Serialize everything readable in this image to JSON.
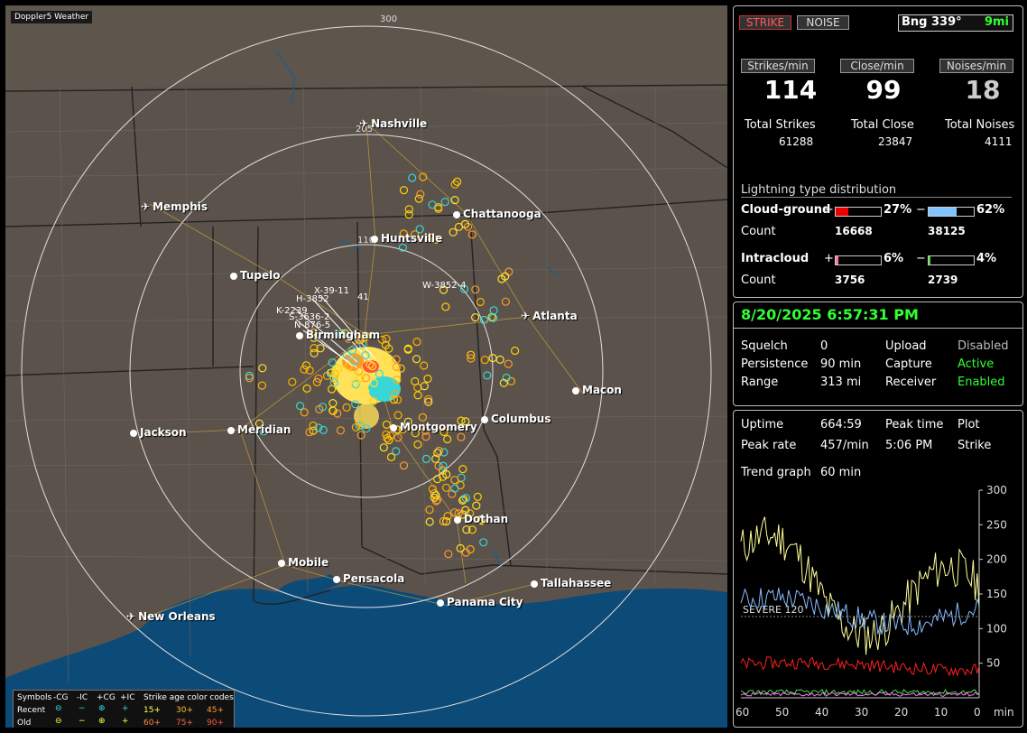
{
  "app_title": "Doppler5 Weather",
  "map": {
    "rings": [
      {
        "label": "300"
      },
      {
        "label": "205"
      },
      {
        "label": "110"
      }
    ],
    "cities": [
      {
        "name": "Nashville",
        "icon": "airport"
      },
      {
        "name": "Memphis",
        "icon": "airport"
      },
      {
        "name": "Chattanooga",
        "icon": "dot"
      },
      {
        "name": "Huntsville",
        "icon": "dot"
      },
      {
        "name": "Tupelo",
        "icon": "dot"
      },
      {
        "name": "Atlanta",
        "icon": "airport"
      },
      {
        "name": "Birmingham",
        "icon": "dot"
      },
      {
        "name": "Macon",
        "icon": "dot"
      },
      {
        "name": "Jackson",
        "icon": "dot"
      },
      {
        "name": "Meridian",
        "icon": "dot"
      },
      {
        "name": "Montgomery",
        "icon": "dot"
      },
      {
        "name": "Columbus",
        "icon": "dot"
      },
      {
        "name": "Dothan",
        "icon": "dot"
      },
      {
        "name": "Mobile",
        "icon": "dot"
      },
      {
        "name": "Pensacola",
        "icon": "dot"
      },
      {
        "name": "Tallahassee",
        "icon": "dot"
      },
      {
        "name": "Panama City",
        "icon": "dot"
      },
      {
        "name": "New Orleans",
        "icon": "airport"
      }
    ],
    "storm_labels": [
      "X-39-11",
      "H-3852",
      "K-2239",
      "S-3636-2",
      "N-876-5",
      "W-3852-4",
      "41"
    ],
    "legend": {
      "symbols_label": "Symbols",
      "headers": [
        "-CG",
        "-IC",
        "+CG",
        "+IC"
      ],
      "age_title": "Strike age color codes",
      "recent_label": "Recent",
      "old_label": "Old",
      "recent_ages": [
        "15+",
        "30+",
        "45+"
      ],
      "old_ages": [
        "60+",
        "75+",
        "90+"
      ]
    }
  },
  "panel": {
    "strike_btn": "STRIKE",
    "noise_btn": "NOISE",
    "bearing": "Bng 339°",
    "distance": "9mi",
    "rate_labels": [
      "Strikes/min",
      "Close/min",
      "Noises/min"
    ],
    "rates": [
      "114",
      "99",
      "18"
    ],
    "total_labels": [
      "Total Strikes",
      "Total Close",
      "Total Noises"
    ],
    "totals": [
      "61288",
      "23847",
      "4111"
    ],
    "dist_title": "Lightning type distribution",
    "cloud_ground": "Cloud-ground",
    "cg_pos_pct": "27%",
    "cg_neg_pct": "62%",
    "cg_pos_frac": 0.27,
    "cg_neg_frac": 0.62,
    "count_label": "Count",
    "cg_pos_count": "16668",
    "cg_neg_count": "38125",
    "intracloud": "Intracloud",
    "ic_pos_pct": "6%",
    "ic_neg_pct": "4%",
    "ic_pos_frac": 0.06,
    "ic_neg_frac": 0.04,
    "ic_pos_count": "3756",
    "ic_neg_count": "2739",
    "plus": "+",
    "minus": "−",
    "datetime": "8/20/2025 6:57:31 PM",
    "settings": {
      "squelch_label": "Squelch",
      "squelch": "0",
      "upload_label": "Upload",
      "upload": "Disabled",
      "persistence_label": "Persistence",
      "persistence": "90 min",
      "capture_label": "Capture",
      "capture": "Active",
      "range_label": "Range",
      "range": "313 mi",
      "receiver_label": "Receiver",
      "receiver": "Enabled"
    },
    "stats": {
      "uptime_label": "Uptime",
      "uptime": "664:59",
      "peak_time_label": "Peak time",
      "plot_label": "Plot",
      "peak_rate_label": "Peak rate",
      "peak_rate": "457/min",
      "peak_time": "5:06 PM",
      "plot": "Strike",
      "trend_label": "Trend graph",
      "trend": "60 min"
    },
    "graph": {
      "y_ticks": [
        "300",
        "250",
        "200",
        "150",
        "100",
        "50"
      ],
      "x_ticks": [
        "60",
        "50",
        "40",
        "30",
        "20",
        "10",
        "0"
      ],
      "x_unit": "min",
      "severe_label": "SEVERE 120",
      "colors": {
        "strikes": "#ffff99",
        "close": "#88bbff",
        "noise": "#ff2020",
        "ic": "#44dd44",
        "ic2": "#ff77ff"
      }
    }
  }
}
